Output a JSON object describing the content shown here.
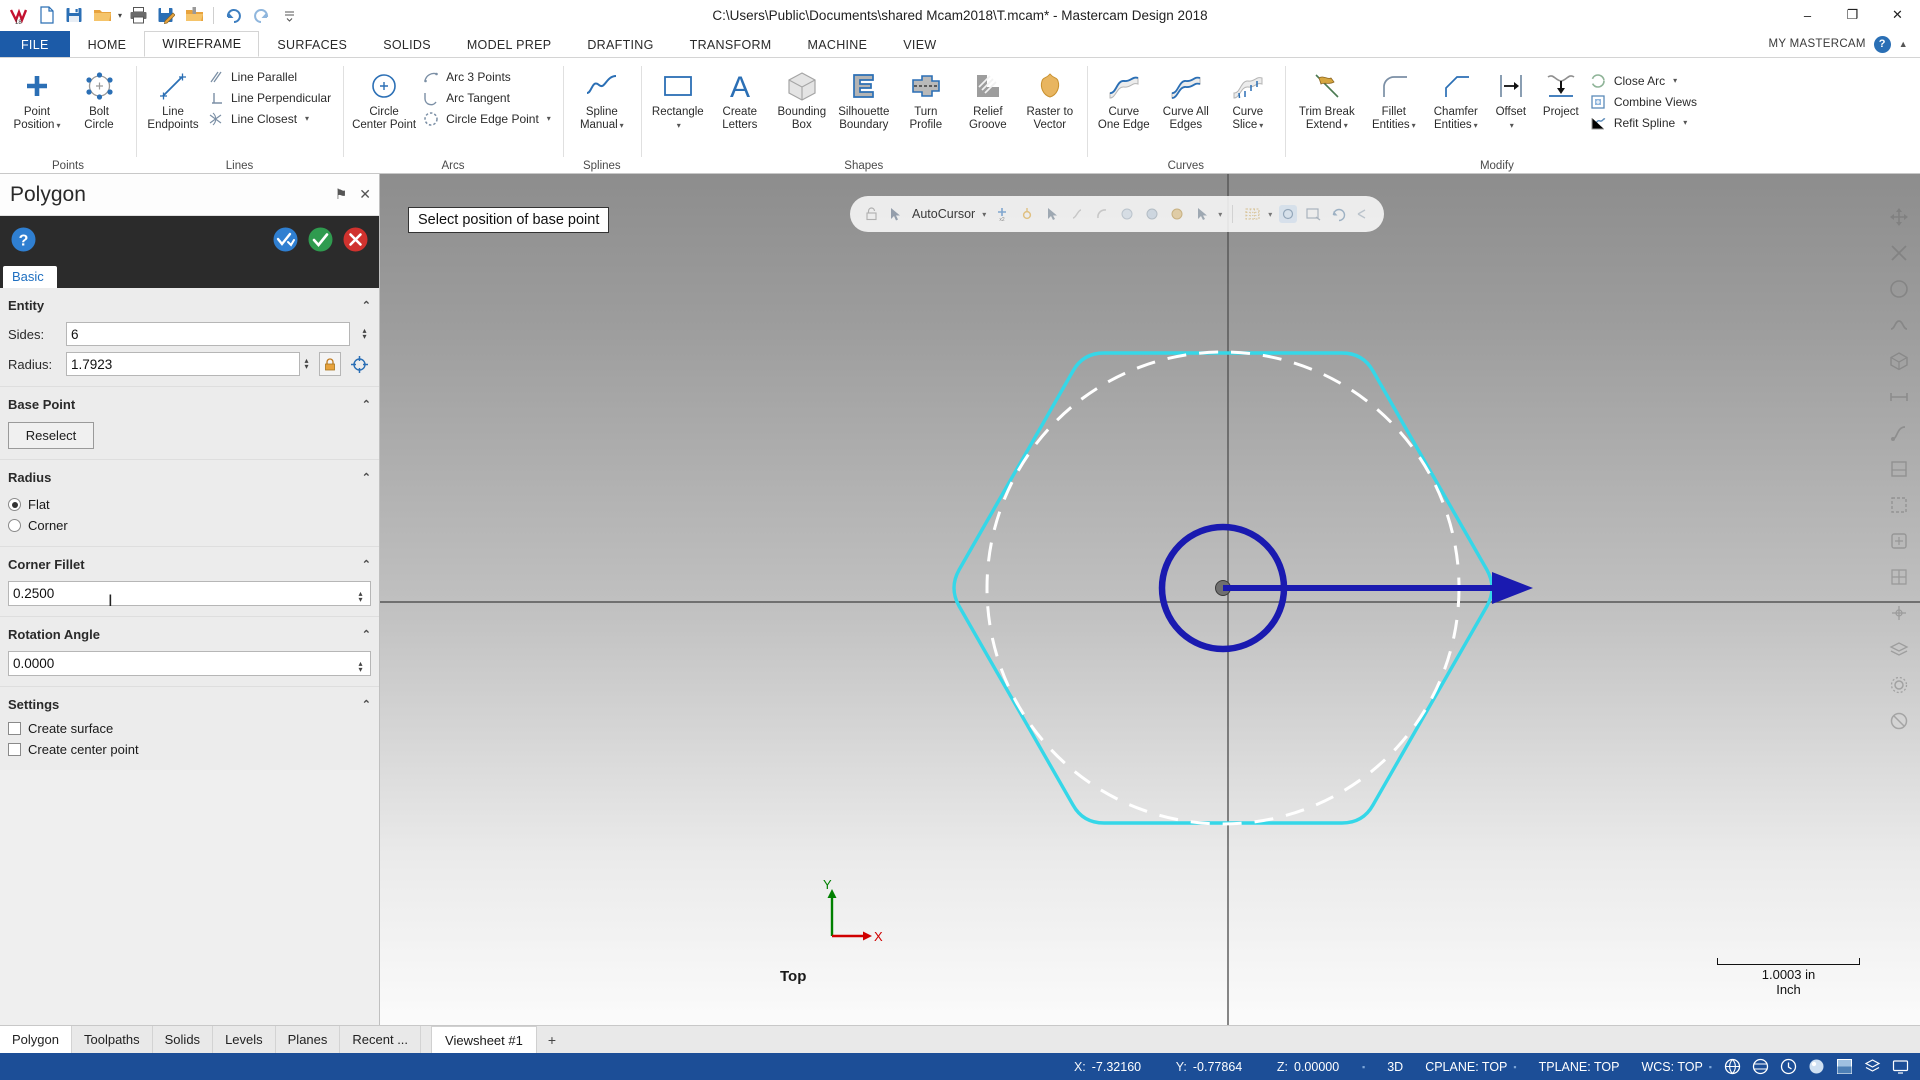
{
  "window": {
    "title": "C:\\Users\\Public\\Documents\\shared Mcam2018\\T.mcam* - Mastercam Design 2018",
    "minimize": "–",
    "restore": "❐",
    "close": "✕"
  },
  "quick_access": [
    {
      "name": "mastercam-logo-icon",
      "label": "Mastercam"
    },
    {
      "name": "new-file-icon",
      "label": "New"
    },
    {
      "name": "save-icon",
      "label": "Save"
    },
    {
      "name": "open-folder-icon",
      "label": "Open"
    },
    {
      "name": "print-icon",
      "label": "Print"
    },
    {
      "name": "save-as-icon",
      "label": "Save As"
    },
    {
      "name": "import-folder-icon",
      "label": "Import"
    },
    {
      "name": "undo-icon",
      "label": "Undo"
    },
    {
      "name": "redo-icon",
      "label": "Redo"
    },
    {
      "name": "customize-qat-icon",
      "label": "Customize Quick Access Toolbar"
    }
  ],
  "ribbon_tabs": [
    {
      "label": "FILE",
      "active": false,
      "file": true
    },
    {
      "label": "HOME",
      "active": false
    },
    {
      "label": "WIREFRAME",
      "active": true
    },
    {
      "label": "SURFACES",
      "active": false
    },
    {
      "label": "SOLIDS",
      "active": false
    },
    {
      "label": "MODEL PREP",
      "active": false
    },
    {
      "label": "DRAFTING",
      "active": false
    },
    {
      "label": "TRANSFORM",
      "active": false
    },
    {
      "label": "MACHINE",
      "active": false
    },
    {
      "label": "VIEW",
      "active": false
    }
  ],
  "my_mastercam": {
    "label": "MY MASTERCAM",
    "help_icon": "?",
    "chevron": "▲"
  },
  "ribbon_groups": [
    {
      "label": "Points",
      "big": [
        {
          "label": "Point\nPosition",
          "icon": "point-position-icon",
          "dropdown": true
        },
        {
          "label": "Bolt\nCircle",
          "icon": "bolt-circle-icon",
          "dropdown": false
        }
      ],
      "small": []
    },
    {
      "label": "Lines",
      "big": [
        {
          "label": "Line\nEndpoints",
          "icon": "line-endpoints-icon",
          "dropdown": false
        }
      ],
      "small": [
        {
          "label": "Line Parallel",
          "icon": "line-parallel-icon",
          "dropdown": false
        },
        {
          "label": "Line Perpendicular",
          "icon": "line-perpendicular-icon",
          "dropdown": false
        },
        {
          "label": "Line Closest",
          "icon": "line-closest-icon",
          "dropdown": true
        }
      ]
    },
    {
      "label": "Arcs",
      "big": [
        {
          "label": "Circle\nCenter Point",
          "icon": "circle-center-point-icon",
          "dropdown": false
        }
      ],
      "small": [
        {
          "label": "Arc 3 Points",
          "icon": "arc-3-points-icon",
          "dropdown": false
        },
        {
          "label": "Arc Tangent",
          "icon": "arc-tangent-icon",
          "dropdown": false
        },
        {
          "label": "Circle Edge Point",
          "icon": "circle-edge-point-icon",
          "dropdown": true
        }
      ]
    },
    {
      "label": "Splines",
      "big": [
        {
          "label": "Spline\nManual",
          "icon": "spline-manual-icon",
          "dropdown": true
        }
      ],
      "small": []
    },
    {
      "label": "Shapes",
      "big": [
        {
          "label": "Rectangle",
          "icon": "rectangle-icon",
          "dropdown": true
        },
        {
          "label": "Create\nLetters",
          "icon": "create-letters-icon",
          "dropdown": false
        },
        {
          "label": "Bounding\nBox",
          "icon": "bounding-box-icon",
          "dropdown": false
        },
        {
          "label": "Silhouette\nBoundary",
          "icon": "silhouette-boundary-icon",
          "dropdown": false
        },
        {
          "label": "Turn\nProfile",
          "icon": "turn-profile-icon",
          "dropdown": false
        },
        {
          "label": "Relief\nGroove",
          "icon": "relief-groove-icon",
          "dropdown": false
        },
        {
          "label": "Raster to\nVector",
          "icon": "raster-to-vector-icon",
          "dropdown": false
        }
      ],
      "small": []
    },
    {
      "label": "Curves",
      "big": [
        {
          "label": "Curve\nOne Edge",
          "icon": "curve-one-edge-icon",
          "dropdown": false
        },
        {
          "label": "Curve All\nEdges",
          "icon": "curve-all-edges-icon",
          "dropdown": false
        },
        {
          "label": "Curve\nSlice",
          "icon": "curve-slice-icon",
          "dropdown": true
        }
      ],
      "small": []
    },
    {
      "label": "Modify",
      "big": [
        {
          "label": "Trim Break\nExtend",
          "icon": "trim-break-extend-icon",
          "dropdown": true
        },
        {
          "label": "Fillet\nEntities",
          "icon": "fillet-entities-icon",
          "dropdown": true
        },
        {
          "label": "Chamfer\nEntities",
          "icon": "chamfer-entities-icon",
          "dropdown": true
        },
        {
          "label": "Offset",
          "icon": "offset-icon",
          "dropdown": true
        },
        {
          "label": "Project",
          "icon": "project-icon",
          "dropdown": false
        }
      ],
      "small": [
        {
          "label": "Close Arc",
          "icon": "close-arc-icon",
          "dropdown": true
        },
        {
          "label": "Combine Views",
          "icon": "combine-views-icon",
          "dropdown": false
        },
        {
          "label": "Refit Spline",
          "icon": "refit-spline-icon",
          "dropdown": true
        }
      ]
    }
  ],
  "panel": {
    "title": "Polygon",
    "pin_icon": "⚑",
    "close_icon": "✕",
    "help_button": "?",
    "apply_button": "apply-icon",
    "ok_button": "ok-icon",
    "cancel_button": "cancel-icon",
    "tabs": [
      {
        "label": "Basic",
        "active": true
      }
    ],
    "sections": [
      {
        "name": "entity",
        "title": "Entity",
        "collapse_icon": "⌃",
        "fields": [
          {
            "label": "Sides:",
            "value": "6",
            "name": "sides"
          },
          {
            "label": "Radius:",
            "value": "1.7923",
            "name": "radius"
          }
        ]
      },
      {
        "name": "base-point",
        "title": "Base Point",
        "collapse_icon": "⌃",
        "button": "Reselect"
      },
      {
        "name": "radius-mode",
        "title": "Radius",
        "collapse_icon": "⌃",
        "options": [
          {
            "label": "Flat",
            "selected": true
          },
          {
            "label": "Corner",
            "selected": false
          }
        ]
      },
      {
        "name": "corner-fillet",
        "title": "Corner Fillet",
        "collapse_icon": "⌃",
        "value": "0.2500"
      },
      {
        "name": "rotation-angle",
        "title": "Rotation Angle",
        "collapse_icon": "⌃",
        "value": "0.0000"
      },
      {
        "name": "settings",
        "title": "Settings",
        "collapse_icon": "⌃",
        "checkboxes": [
          {
            "label": "Create surface",
            "checked": false
          },
          {
            "label": "Create center point",
            "checked": false
          }
        ]
      }
    ]
  },
  "graphics": {
    "prompt": "Select position of base point",
    "autocursor": {
      "label": "AutoCursor",
      "dropdown_caret": "▾"
    },
    "view_label": "Top",
    "axis": {
      "x": "X",
      "y": "Y"
    },
    "scale": {
      "value": "1.0003 in",
      "unit": "Inch"
    },
    "colors": {
      "polygon_cyan": "#35d7e8",
      "circle_blue": "#1a1ab0",
      "dashed_white": "#ffffff",
      "axis_gray": "#555555",
      "axis_x": "#d00000",
      "axis_y": "#008000"
    }
  },
  "bottom_tabs": [
    {
      "label": "Polygon",
      "active": true
    },
    {
      "label": "Toolpaths",
      "active": false
    },
    {
      "label": "Solids",
      "active": false
    },
    {
      "label": "Levels",
      "active": false
    },
    {
      "label": "Planes",
      "active": false
    },
    {
      "label": "Recent ...",
      "active": false
    }
  ],
  "viewsheet": {
    "label": "Viewsheet #1",
    "add": "+"
  },
  "status": {
    "x_label": "X:",
    "x_value": "-7.32160",
    "y_label": "Y:",
    "y_value": "-0.77864",
    "z_label": "Z:",
    "z_value": "0.00000",
    "mode": "3D",
    "cplane": "CPLANE: TOP",
    "tplane": "TPLANE: TOP",
    "wcs": "WCS: TOP",
    "separator": "▪",
    "icons": [
      "globe-icon",
      "globe-alt-icon",
      "clock-icon",
      "sphere-icon",
      "gradient-icon",
      "layers-icon",
      "monitor-icon"
    ]
  }
}
